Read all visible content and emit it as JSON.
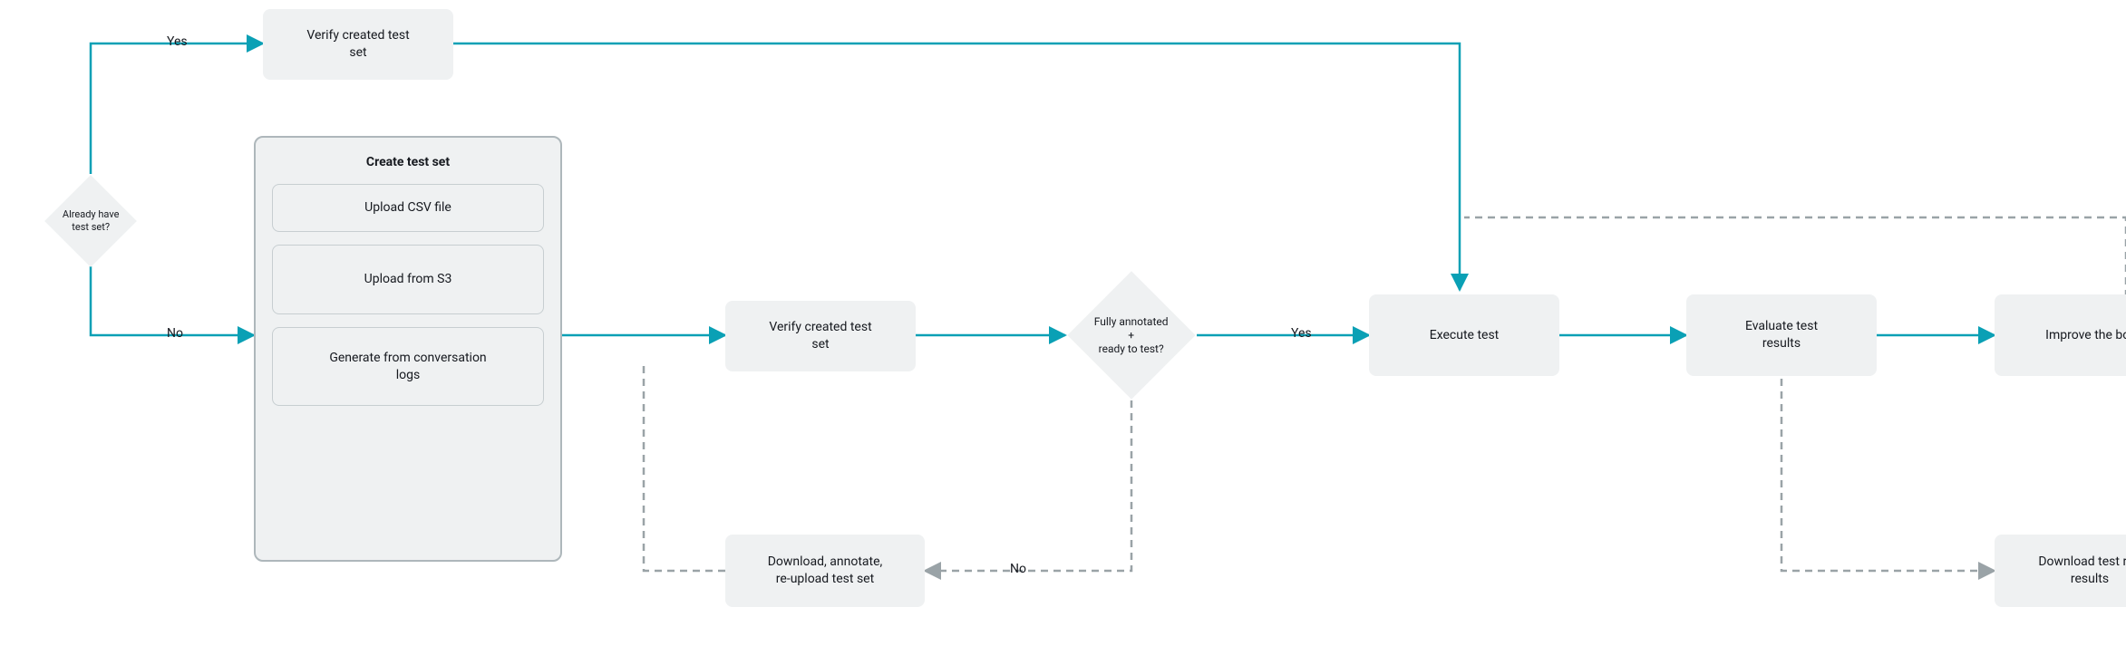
{
  "colors": {
    "teal": "#0aa0b5",
    "grey_dash": "#9aa3a7",
    "node_bg": "#eff1f2",
    "group_border": "#aeb7bb"
  },
  "decision_have": {
    "label": "Already have\ntest set?",
    "yes": "Yes",
    "no": "No"
  },
  "verify_top": "Verify created test\nset",
  "create_group": {
    "title": "Create test set",
    "option_csv": "Upload CSV file",
    "option_s3": "Upload from S3",
    "option_logs": "Generate from conversation\nlogs"
  },
  "verify_mid": "Verify created test\nset",
  "decision_annotated": {
    "label": "Fully annotated\n+\nready to test?",
    "yes": "Yes",
    "no": "No"
  },
  "annotate_loop": "Download, annotate,\nre-upload test set",
  "execute": "Execute test",
  "evaluate": "Evaluate test\nresults",
  "improve": "Improve the bot",
  "download_results": "Download test run\nresults"
}
